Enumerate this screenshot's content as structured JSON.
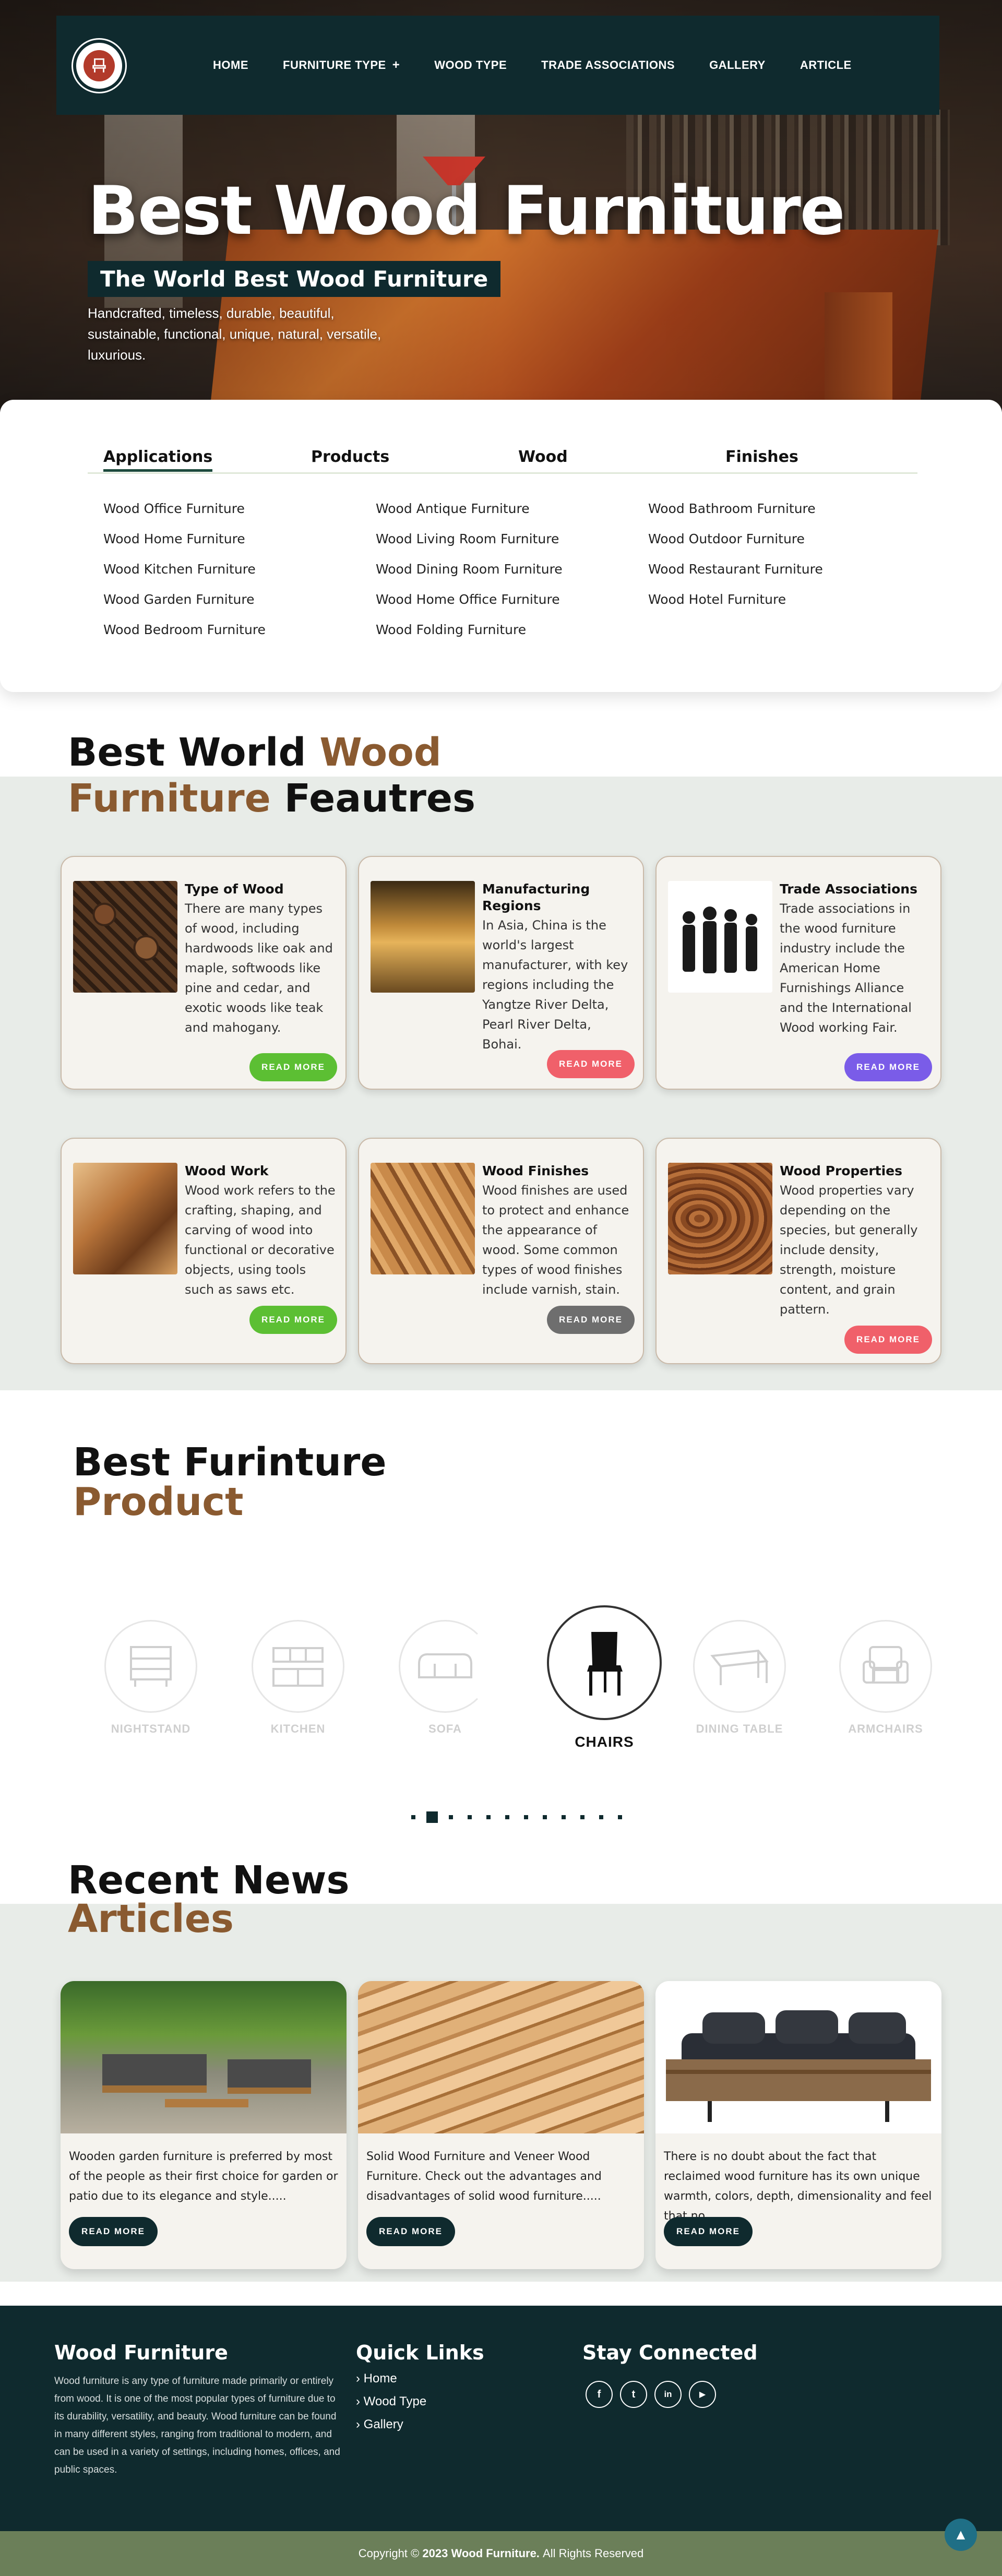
{
  "nav": {
    "logo_icon": "chair-logo-icon",
    "items": [
      {
        "label": "HOME"
      },
      {
        "label": "FURNITURE TYPE",
        "has_submenu": true,
        "submenu_glyph": "+"
      },
      {
        "label": "WOOD TYPE"
      },
      {
        "label": "TRADE ASSOCIATIONS"
      },
      {
        "label": "GALLERY"
      },
      {
        "label": "ARTICLE"
      }
    ]
  },
  "hero": {
    "title": "Best Wood Furniture",
    "badge": "The World Best Wood Furniture",
    "description": "Handcrafted, timeless, durable, beautiful, sustainable, functional, unique, natural, versatile, luxurious."
  },
  "categories": {
    "tabs": [
      "Applications",
      "Products",
      "Wood",
      "Finishes"
    ],
    "active_tab": "Applications",
    "columns": [
      [
        "Wood Office Furniture",
        "Wood Home Furniture",
        "Wood Kitchen Furniture",
        "Wood Garden Furniture",
        "Wood Bedroom Furniture"
      ],
      [
        "Wood Antique Furniture",
        "Wood Living Room Furniture",
        "Wood Dining Room Furniture",
        "Wood Home Office Furniture",
        "Wood Folding Furniture"
      ],
      [
        "Wood Bathroom Furniture",
        "Wood Outdoor Furniture",
        "Wood Restaurant Furniture",
        "Wood Hotel Furniture"
      ]
    ]
  },
  "features": {
    "title_part1": "Best World",
    "title_part2": "Wood",
    "title_part3": "Furniture",
    "title_part4": "Feautres",
    "cards": [
      {
        "title": "Type of Wood",
        "desc": "There are many types of wood, including hardwoods like oak and maple, softwoods like pine and cedar, and exotic woods like teak and mahogany.",
        "button": "READ MORE",
        "button_color": "#5cbf33"
      },
      {
        "title": "Manufacturing Regions",
        "desc": "In Asia, China is the world's largest manufacturer, with key regions including the Yangtze River Delta, Pearl River Delta, Bohai.",
        "button": "READ MORE",
        "button_color": "#f0606a"
      },
      {
        "title": "Trade Associations",
        "desc": "Trade associations in the wood furniture industry include the American Home Furnishings Alliance and the International Wood working Fair.",
        "button": "READ MORE",
        "button_color": "#7a5ce8"
      },
      {
        "title": "Wood Work",
        "desc": "Wood work refers to the crafting, shaping, and carving of wood into functional or decorative objects, using tools such as saws etc.",
        "button": "READ MORE",
        "button_color": "#5cbf33"
      },
      {
        "title": "Wood Finishes",
        "desc": "Wood finishes are used to protect and enhance the appearance of wood. Some common types of wood finishes include varnish, stain.",
        "button": "READ MORE",
        "button_color": "#6e6e6e"
      },
      {
        "title": "Wood Properties",
        "desc": "Wood properties vary depending on the species, but generally include density, strength, moisture content, and grain pattern.",
        "button": "READ MORE",
        "button_color": "#f0606a"
      }
    ]
  },
  "products": {
    "title_part1": "Best Furinture",
    "title_part2": "Product",
    "items": [
      {
        "label": "NIGHTSTAND",
        "icon": "nightstand-icon"
      },
      {
        "label": "KITCHEN",
        "icon": "kitchen-icon"
      },
      {
        "label": "SOFA",
        "icon": "sofa-icon"
      },
      {
        "label": "CHAIRS",
        "icon": "chair-icon",
        "active": true
      },
      {
        "label": "DINING TABLE",
        "icon": "dining-table-icon"
      },
      {
        "label": "ARMCHAIRS",
        "icon": "armchair-icon"
      }
    ],
    "pagination_count": 12,
    "pagination_active": 2
  },
  "news": {
    "title_part1": "Recent News",
    "title_part2": "Articles",
    "articles": [
      {
        "text": "Wooden garden furniture is preferred by most of the people as their first choice for garden or patio due to its elegance and style.....",
        "button": "READ MORE"
      },
      {
        "text": "Solid Wood Furniture and Veneer Wood Furniture. Check out the advantages and disadvantages of solid wood furniture.....",
        "button": "READ MORE"
      },
      {
        "text": "There is no doubt about the fact that reclaimed wood furniture has its own unique warmth, colors, depth, dimensionality and feel that no...",
        "button": "READ MORE"
      }
    ]
  },
  "footer": {
    "about_title": "Wood Furniture",
    "about_text": "Wood furniture is any type of furniture made primarily or entirely from wood. It is one of the most popular types of furniture due to its durability, versatility, and beauty. Wood furniture can be found in many different styles, ranging from traditional to modern, and can be used in a variety of settings, including homes, offices, and public spaces.",
    "links_title": "Quick Links",
    "links": [
      "Home",
      "Wood Type",
      "Gallery"
    ],
    "link_glyph": "›",
    "social_title": "Stay Connected",
    "social": [
      {
        "icon": "facebook-icon",
        "glyph": "f"
      },
      {
        "icon": "twitter-icon",
        "glyph": "t"
      },
      {
        "icon": "linkedin-icon",
        "glyph": "in"
      },
      {
        "icon": "youtube-icon",
        "glyph": "▶"
      }
    ],
    "copyright_prefix": "Copyright ©",
    "copyright_year": "2023",
    "copyright_brand": "Wood Furniture.",
    "copyright_suffix": "All Rights Reserved",
    "to_top_glyph": "▲"
  },
  "colors": {
    "primary_dark": "#0f2a2e",
    "accent_brown": "#8a5a30",
    "footer_bar": "#6b7f59",
    "to_top": "#1f6f86"
  }
}
